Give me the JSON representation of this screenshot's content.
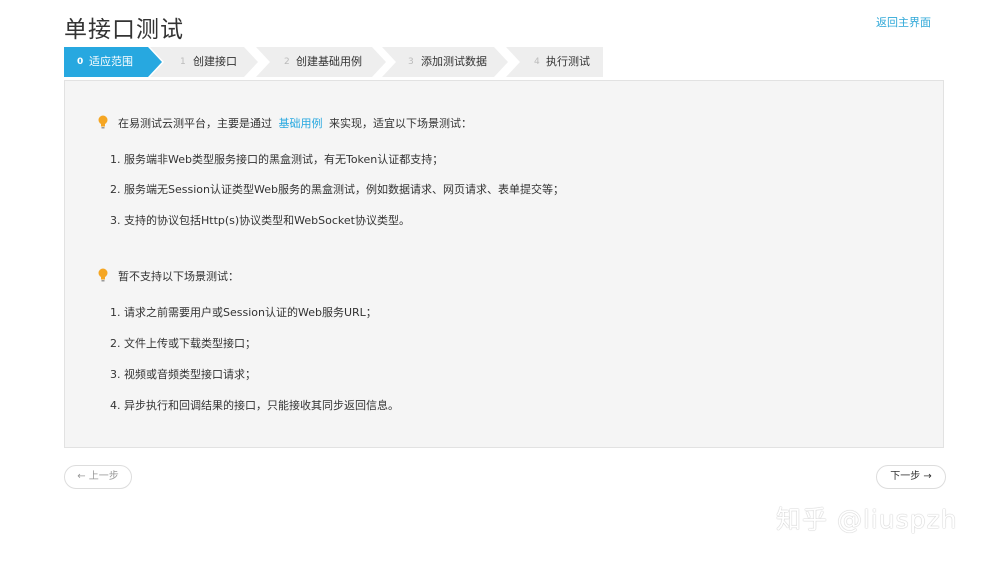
{
  "header": {
    "title": "单接口测试",
    "back_label": "返回主界面"
  },
  "steps": [
    {
      "num": "0",
      "label": "适应范围",
      "active": true
    },
    {
      "num": "1",
      "label": "创建接口",
      "active": false
    },
    {
      "num": "2",
      "label": "创建基础用例",
      "active": false
    },
    {
      "num": "3",
      "label": "添加测试数据",
      "active": false
    },
    {
      "num": "4",
      "label": "执行测试",
      "active": false
    }
  ],
  "supported": {
    "intro_before": "在易测试云测平台，主要是通过",
    "intro_link": "基础用例",
    "intro_after": "来实现，适宜以下场景测试：",
    "items": [
      "1. 服务端非Web类型服务接口的黑盒测试，有无Token认证都支持；",
      "2. 服务端无Session认证类型Web服务的黑盒测试，例如数据请求、网页请求、表单提交等；",
      "3. 支持的协议包括Http(s)协议类型和WebSocket协议类型。"
    ]
  },
  "unsupported": {
    "intro": "暂不支持以下场景测试：",
    "items": [
      "1. 请求之前需要用户或Session认证的Web服务URL；",
      "2. 文件上传或下载类型接口；",
      "3. 视频或音频类型接口请求；",
      "4. 异步执行和回调结果的接口，只能接收其同步返回信息。"
    ]
  },
  "nav": {
    "prev_label": "← 上一步",
    "next_label": "下一步 →"
  },
  "watermark": "知乎 @liuspzh",
  "colors": {
    "accent": "#27a8e0",
    "bulb": "#f5a623"
  }
}
